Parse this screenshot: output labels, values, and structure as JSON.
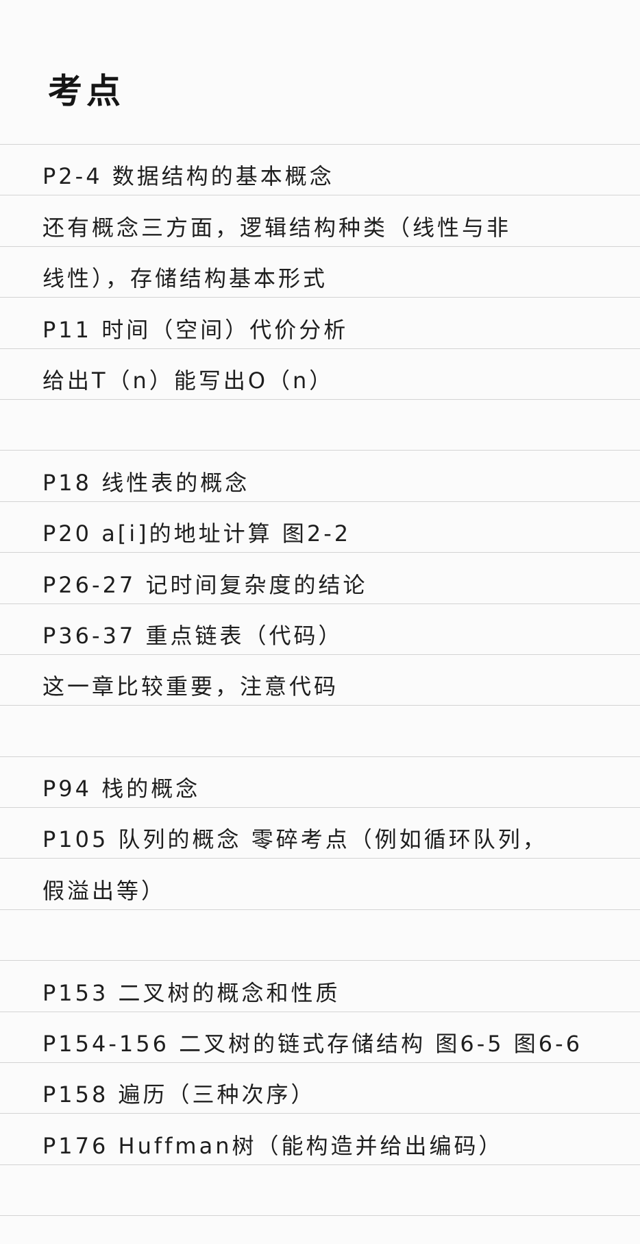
{
  "title": "考点",
  "lines": [
    "P2-4 数据结构的基本概念",
    "还有概念三方面，逻辑结构种类（线性与非",
    "线性），存储结构基本形式",
    "P11 时间（空间）代价分析",
    "给出T（n）能写出O（n）",
    "",
    "P18 线性表的概念",
    "P20 a[i]的地址计算 图2-2",
    "P26-27 记时间复杂度的结论",
    "P36-37 重点链表（代码）",
    "这一章比较重要，注意代码",
    "",
    "P94 栈的概念",
    "P105 队列的概念 零碎考点（例如循环队列，",
    "假溢出等）",
    "",
    "P153 二叉树的概念和性质",
    "P154-156 二叉树的链式存储结构 图6-5 图6-6",
    "P158 遍历（三种次序）",
    "P176 Huffman树（能构造并给出编码）",
    ""
  ]
}
